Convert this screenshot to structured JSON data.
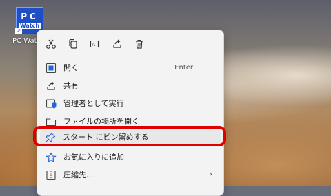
{
  "desktop": {
    "icon_line1": "PC",
    "icon_line2": "Watch",
    "label": "PC Watch"
  },
  "quickbar": {
    "icons": [
      "cut-icon",
      "copy-icon",
      "rename-icon",
      "share-icon",
      "delete-icon"
    ]
  },
  "menu": {
    "items": [
      {
        "label": "開く",
        "shortcut": "Enter",
        "icon": "open-icon"
      },
      {
        "label": "共有",
        "icon": "share-icon"
      },
      {
        "label": "管理者として実行",
        "icon": "shield-icon"
      },
      {
        "label": "ファイルの場所を開く",
        "icon": "folder-icon"
      },
      {
        "label": "スタート にピン留めする",
        "icon": "pin-icon"
      },
      {
        "label": "お気に入りに追加",
        "icon": "star-icon"
      },
      {
        "label": "圧縮先...",
        "icon": "zip-icon",
        "has_submenu": true
      }
    ]
  },
  "colors": {
    "highlight": "#e00000",
    "menu_bg": "#f3f3f3",
    "accent": "#1f4fc6"
  }
}
